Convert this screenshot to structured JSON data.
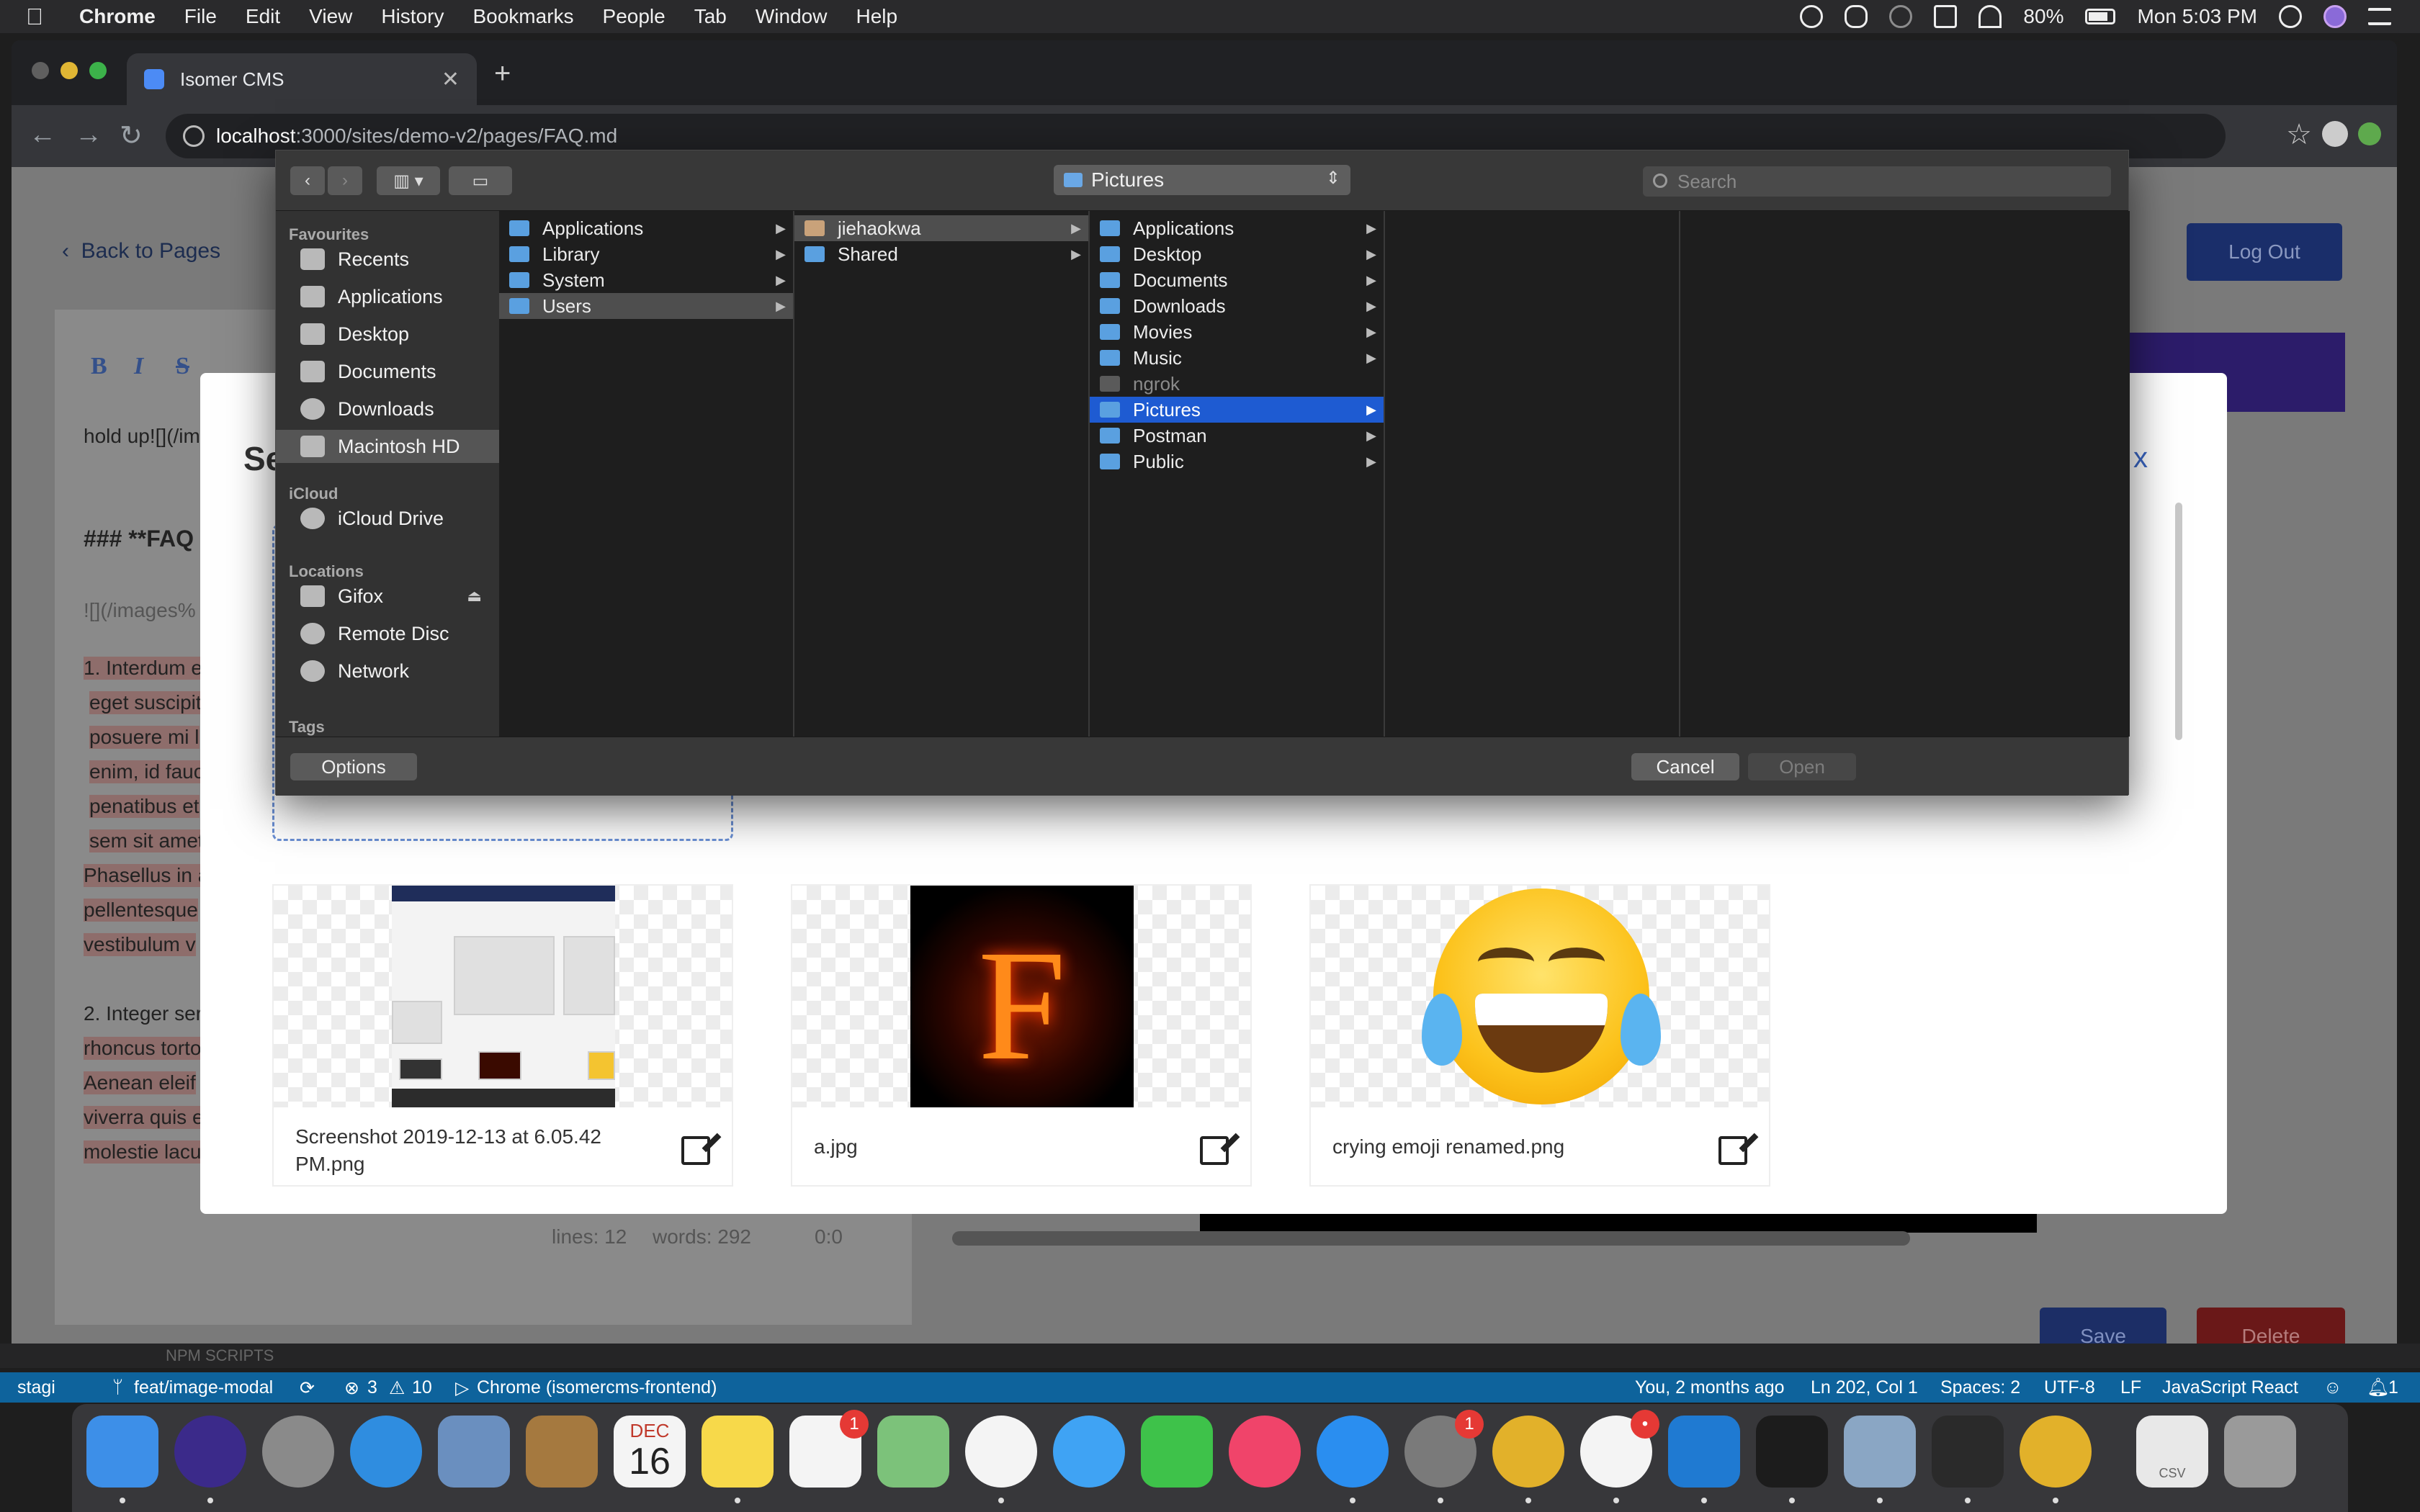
{
  "menubar": {
    "app": "Chrome",
    "items": [
      "File",
      "Edit",
      "View",
      "History",
      "Bookmarks",
      "People",
      "Tab",
      "Window",
      "Help"
    ],
    "battery": "80%",
    "clock": "Mon 5:03 PM",
    "status_icons": [
      "onepassword-icon",
      "glasses-icon",
      "gauge-icon",
      "airplay-icon",
      "wifi-icon",
      "battery-icon",
      "spotlight-icon",
      "siri-icon",
      "notification-center-icon"
    ]
  },
  "browser": {
    "tab_title": "Isomer CMS",
    "url_host": "localhost",
    "url_path": ":3000/sites/demo-v2/pages/FAQ.md"
  },
  "page": {
    "back_label": "Back to Pages",
    "logout_label": "Log Out",
    "save_label": "Save",
    "delete_label": "Delete",
    "format_buttons": [
      "B",
      "I",
      "S"
    ],
    "editor_lines": [
      "hold up![](/im",
      "### **FAQ",
      "![](/images%",
      "1. Interdum e",
      "eget suscipit",
      "posuere mi l",
      "enim, id fauc",
      "penatibus et",
      "sem sit amet",
      "Phasellus in a",
      "pellentesque",
      "vestibulum v",
      "2. Integer ser",
      "rhoncus torto",
      "Aenean eleif",
      "viverra quis e",
      "molestie lacu"
    ],
    "status_lines": "lines: 12",
    "status_words": "words: 292",
    "status_pos": "0:0"
  },
  "modal": {
    "title_partial": "Sel",
    "close_partial": "x",
    "images": [
      {
        "name": "Screenshot 2019-12-13 at 6.05.42 PM.png"
      },
      {
        "name": "a.jpg"
      },
      {
        "name": "crying emoji renamed.png"
      }
    ]
  },
  "dialog": {
    "location": "Pictures",
    "search_placeholder": "Search",
    "sidebar": {
      "favourites_label": "Favourites",
      "favourites": [
        "Recents",
        "Applications",
        "Desktop",
        "Documents",
        "Downloads",
        "Macintosh HD"
      ],
      "icloud_label": "iCloud",
      "icloud": [
        "iCloud Drive"
      ],
      "locations_label": "Locations",
      "locations": [
        "Gifox",
        "Remote Disc",
        "Network"
      ],
      "tags_label": "Tags"
    },
    "columns": {
      "root": [
        "Applications",
        "Library",
        "System",
        "Users"
      ],
      "users": [
        "jiehaokwa",
        "Shared"
      ],
      "home": [
        "Applications",
        "Desktop",
        "Documents",
        "Downloads",
        "Movies",
        "Music",
        "ngrok",
        "Pictures",
        "Postman",
        "Public"
      ]
    },
    "options_label": "Options",
    "cancel_label": "Cancel",
    "open_label": "Open"
  },
  "vscode": {
    "strip_label": "NPM SCRIPTS",
    "branch_partial": "stagi",
    "branch": "feat/image-modal",
    "errors": "3",
    "warnings": "10",
    "debug_target": "Chrome (isomercms-frontend)",
    "blame": "You, 2 months ago",
    "cursor": "Ln 202, Col 1",
    "spaces": "Spaces: 2",
    "encoding": "UTF-8",
    "eol": "LF",
    "language": "JavaScript React",
    "notifications": "1"
  },
  "dock": {
    "apps": [
      {
        "name": "finder-icon",
        "color": "#3d8fe8",
        "badge": ""
      },
      {
        "name": "siri-icon",
        "color": "#3b2a8a",
        "badge": ""
      },
      {
        "name": "launchpad-icon",
        "color": "#8a8a8a",
        "badge": ""
      },
      {
        "name": "safari-icon",
        "color": "#2f8de0",
        "badge": ""
      },
      {
        "name": "preview-bird-icon",
        "color": "#6a8fbf",
        "badge": ""
      },
      {
        "name": "contacts-icon",
        "color": "#a5793f",
        "badge": ""
      },
      {
        "name": "calendar-icon",
        "color": "#f4f4f4",
        "badge": ""
      },
      {
        "name": "notes-icon",
        "color": "#f7d94a",
        "badge": ""
      },
      {
        "name": "reminders-icon",
        "color": "#f4f4f4",
        "badge": "1"
      },
      {
        "name": "maps-icon",
        "color": "#7cc27a",
        "badge": ""
      },
      {
        "name": "photos-icon",
        "color": "#f4f4f4",
        "badge": ""
      },
      {
        "name": "messages-icon",
        "color": "#3fa3f4",
        "badge": ""
      },
      {
        "name": "facetime-icon",
        "color": "#3ec24a",
        "badge": ""
      },
      {
        "name": "music-icon",
        "color": "#f0446a",
        "badge": ""
      },
      {
        "name": "app-store-icon",
        "color": "#2a8ef0",
        "badge": ""
      },
      {
        "name": "system-preferences-icon",
        "color": "#7a7a7a",
        "badge": "1"
      },
      {
        "name": "chrome-icon",
        "color": "#e2b12a",
        "badge": ""
      },
      {
        "name": "slack-icon",
        "color": "#f4f4f4",
        "badge": "•"
      },
      {
        "name": "vscode-icon",
        "color": "#1f7ad2",
        "badge": ""
      },
      {
        "name": "terminal-icon",
        "color": "#1c1c1c",
        "badge": ""
      },
      {
        "name": "image-capture-icon",
        "color": "#8aa6c4",
        "badge": ""
      },
      {
        "name": "activity-monitor-icon",
        "color": "#2a2a2a",
        "badge": ""
      },
      {
        "name": "chrome-canary-icon",
        "color": "#e2b12a",
        "badge": ""
      },
      {
        "name": "downloads-stack-icon",
        "color": "#e8e8e8",
        "badge": ""
      },
      {
        "name": "trash-icon",
        "color": "#9a9a9a",
        "badge": ""
      }
    ],
    "calendar_month": "DEC",
    "calendar_day": "16",
    "stack_label": "CSV"
  }
}
